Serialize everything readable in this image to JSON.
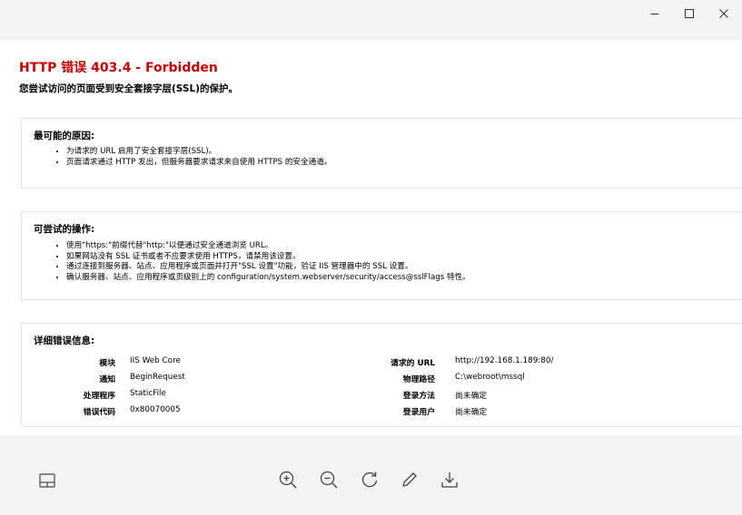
{
  "window": {
    "controls": [
      "minimize-icon",
      "maximize-icon",
      "close-icon"
    ]
  },
  "error": {
    "title": "HTTP 错误 403.4 - Forbidden",
    "subtitle": "您尝试访问的页面受到安全套接字层(SSL)的保护。"
  },
  "causes": {
    "heading": "最可能的原因:",
    "items": [
      "为请求的 URL 启用了安全套接字层(SSL)。",
      "页面请求通过 HTTP 发出，但服务器要求请求来自使用 HTTPS 的安全通道。"
    ]
  },
  "actions": {
    "heading": "可尝试的操作:",
    "items": [
      "使用\"https:\"前缀代替\"http:\"以便通过安全通道浏览 URL。",
      "如果网站没有 SSL 证书或者不应要求使用 HTTPS，请禁用该设置。",
      "通过连接到服务器、站点、应用程序或页面并打开\"SSL 设置\"功能，验证 IIS 管理器中的 SSL 设置。",
      "确认服务器、站点、应用程序或页级别上的 configuration/system.webserver/security/access@sslFlags 特性。"
    ]
  },
  "details": {
    "heading": "详细错误信息:",
    "rows": [
      {
        "left_label": "模块",
        "left_value": "IIS Web Core",
        "right_label": "请求的 URL",
        "right_value": "http://192.168.1.189:80/"
      },
      {
        "left_label": "通知",
        "left_value": "BeginRequest",
        "right_label": "物理路径",
        "right_value": "C:\\webroot\\mssql"
      },
      {
        "left_label": "处理程序",
        "left_value": "StaticFile",
        "right_label": "登录方法",
        "right_value": "尚未确定"
      },
      {
        "left_label": "错误代码",
        "left_value": "0x80070005",
        "right_label": "登录用户",
        "right_value": "尚未确定"
      }
    ]
  },
  "toolbar": {
    "icons": [
      "panel-toggle-icon",
      "zoom-in-icon",
      "zoom-out-icon",
      "rotate-icon",
      "edit-icon",
      "download-icon"
    ]
  }
}
